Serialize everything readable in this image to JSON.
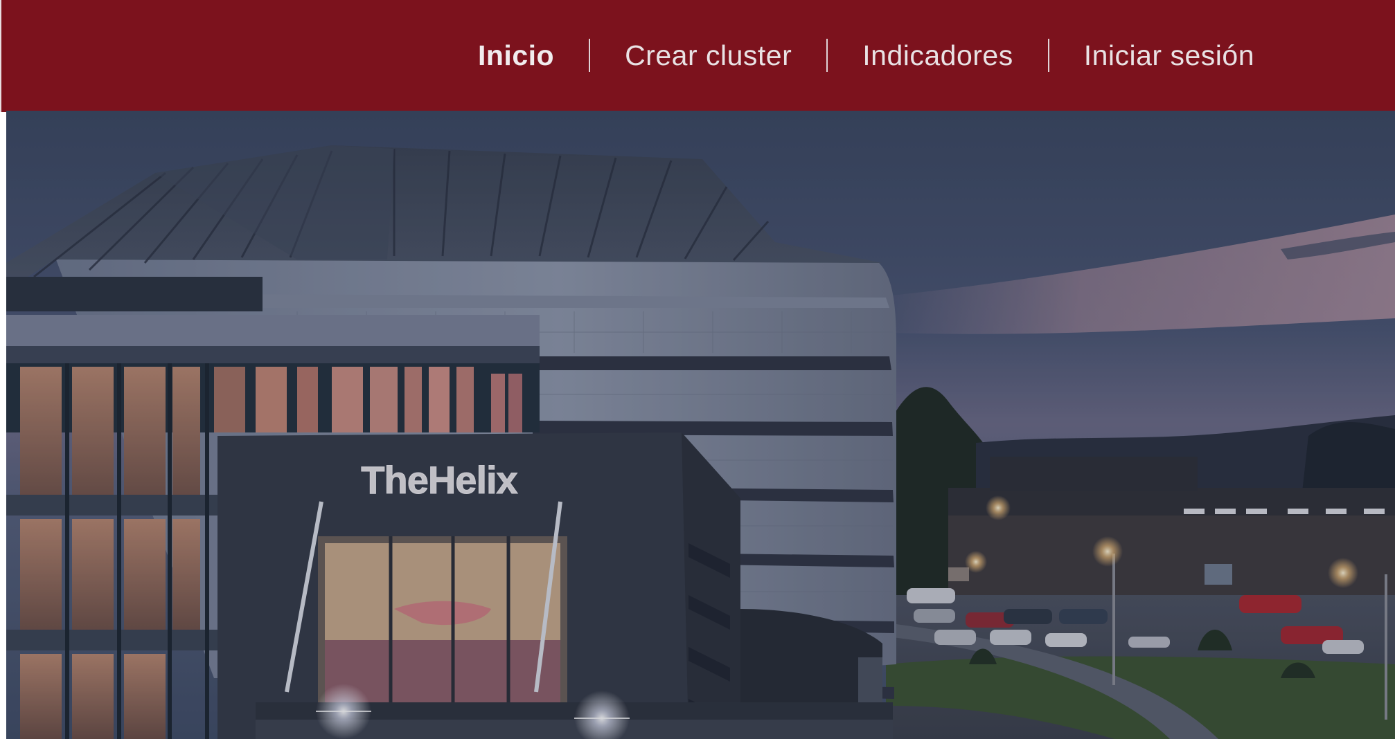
{
  "nav": {
    "items": [
      {
        "label": "Inicio",
        "active": true
      },
      {
        "label": "Crear cluster",
        "active": false
      },
      {
        "label": "Indicadores",
        "active": false
      },
      {
        "label": "Iniciar sesión",
        "active": false
      }
    ]
  },
  "hero": {
    "sign_text": "TheHelix"
  },
  "colors": {
    "navbar": "#7c121d",
    "nav_text": "#e9e2e4",
    "sky_top": "#3e4b63",
    "sky_glow": "#8f8199"
  }
}
